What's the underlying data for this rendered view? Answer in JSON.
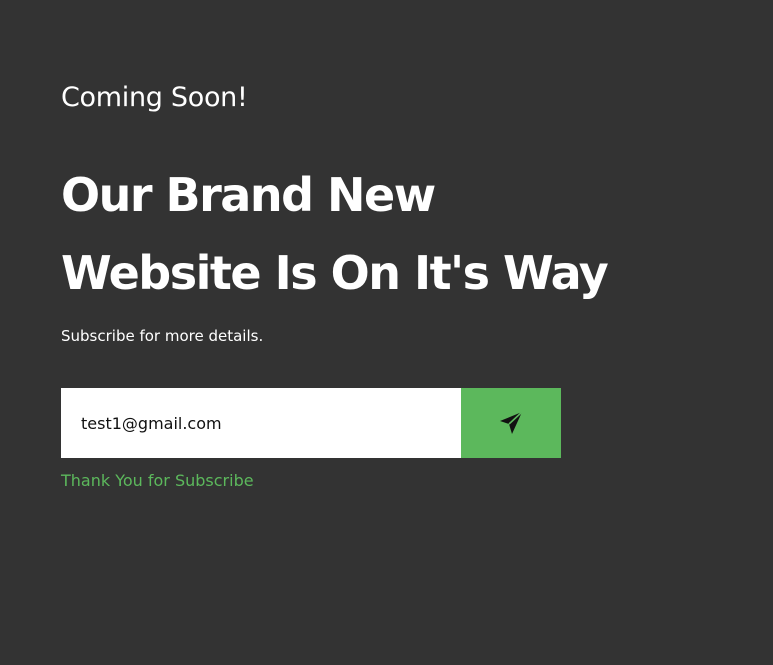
{
  "hero": {
    "eyebrow": "Coming Soon!",
    "headline_line1": "Our Brand New",
    "headline_line2": "Website Is On It's Way",
    "subtext": "Subscribe for more details."
  },
  "subscribe": {
    "email_value": "test1@gmail.com",
    "submit_icon": "send-paper-plane-icon",
    "success_message": "Thank You for Subscribe"
  },
  "colors": {
    "background": "#333333",
    "text": "#ffffff",
    "accent": "#5cb85c",
    "input_background": "#ffffff"
  }
}
